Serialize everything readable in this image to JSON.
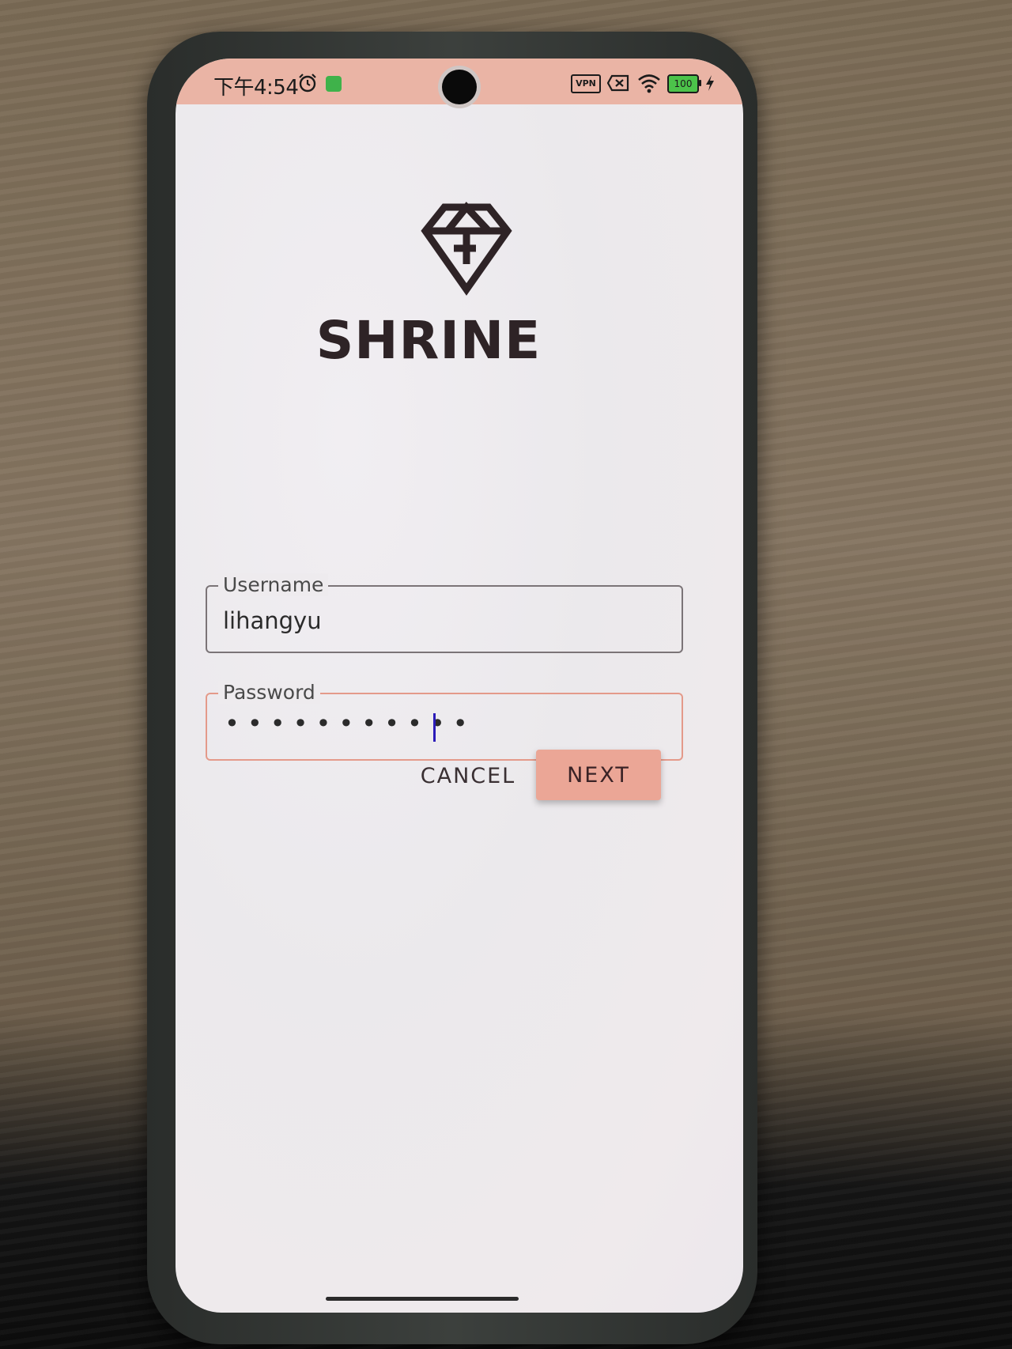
{
  "status_bar": {
    "time": "下午4:54",
    "vpn_label": "VPN",
    "battery_level": "100",
    "icons": [
      "alarm-icon",
      "app-notify-icon",
      "vpn-icon",
      "sim-x-icon",
      "wifi-icon",
      "battery-icon",
      "charge-icon"
    ]
  },
  "app": {
    "title": "SHRINE",
    "logo_icon": "diamond-logo-icon"
  },
  "login_form": {
    "username": {
      "label": "Username",
      "value": "lihangyu"
    },
    "password": {
      "label": "Password",
      "masked_value": "•••••••••••",
      "focused": true
    }
  },
  "actions": {
    "cancel_label": "CANCEL",
    "next_label": "NEXT"
  },
  "colors": {
    "accent": "#eba696",
    "status_bar": "#eab4a5",
    "text_dark": "#2e2326",
    "focus_border": "#e49a8a"
  }
}
